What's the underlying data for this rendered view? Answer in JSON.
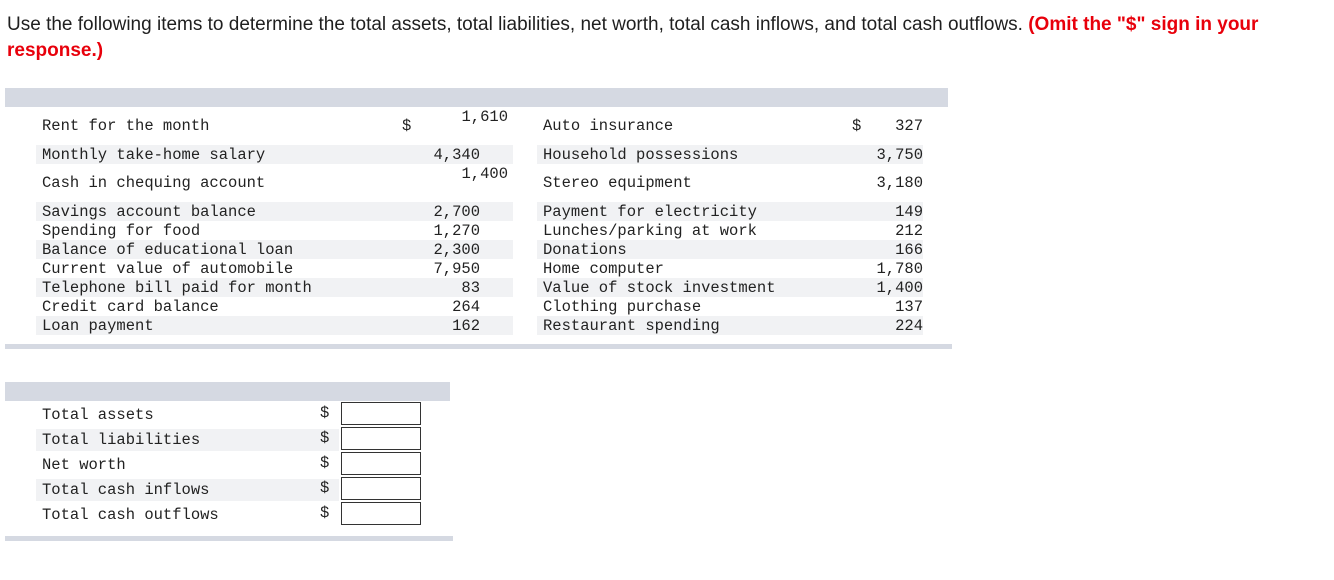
{
  "question": {
    "text": "Use the following items to determine the total assets, total liabilities, net worth, total cash inflows, and total cash outflows.",
    "emphasis": "(Omit the \"$\" sign in your response.)"
  },
  "currency_symbol": "$",
  "items_left": [
    {
      "label": "Rent for the month",
      "value": "1,610"
    },
    {
      "label": "Monthly take-home salary",
      "value": "4,340"
    },
    {
      "label": "Cash in chequing account",
      "value": "1,400"
    },
    {
      "label": "Savings account balance",
      "value": "2,700"
    },
    {
      "label": "Spending for food",
      "value": "1,270"
    },
    {
      "label": "Balance of educational loan",
      "value": "2,300"
    },
    {
      "label": "Current value of automobile",
      "value": "7,950"
    },
    {
      "label": "Telephone bill paid for month",
      "value": "83"
    },
    {
      "label": "Credit card balance",
      "value": "264"
    },
    {
      "label": "Loan payment",
      "value": "162"
    }
  ],
  "items_right": [
    {
      "label": "Auto insurance",
      "value": "327"
    },
    {
      "label": "Household possessions",
      "value": "3,750"
    },
    {
      "label": "Stereo equipment",
      "value": "3,180"
    },
    {
      "label": "Payment for electricity",
      "value": "149"
    },
    {
      "label": "Lunches/parking at work",
      "value": "212"
    },
    {
      "label": "Donations",
      "value": "166"
    },
    {
      "label": "Home computer",
      "value": "1,780"
    },
    {
      "label": "Value of stock investment",
      "value": "1,400"
    },
    {
      "label": "Clothing purchase",
      "value": "137"
    },
    {
      "label": "Restaurant spending",
      "value": "224"
    }
  ],
  "answers": [
    {
      "label": "Total assets",
      "value": ""
    },
    {
      "label": "Total liabilities",
      "value": ""
    },
    {
      "label": "Net worth",
      "value": ""
    },
    {
      "label": "Total cash inflows",
      "value": ""
    },
    {
      "label": "Total cash outflows",
      "value": ""
    }
  ]
}
